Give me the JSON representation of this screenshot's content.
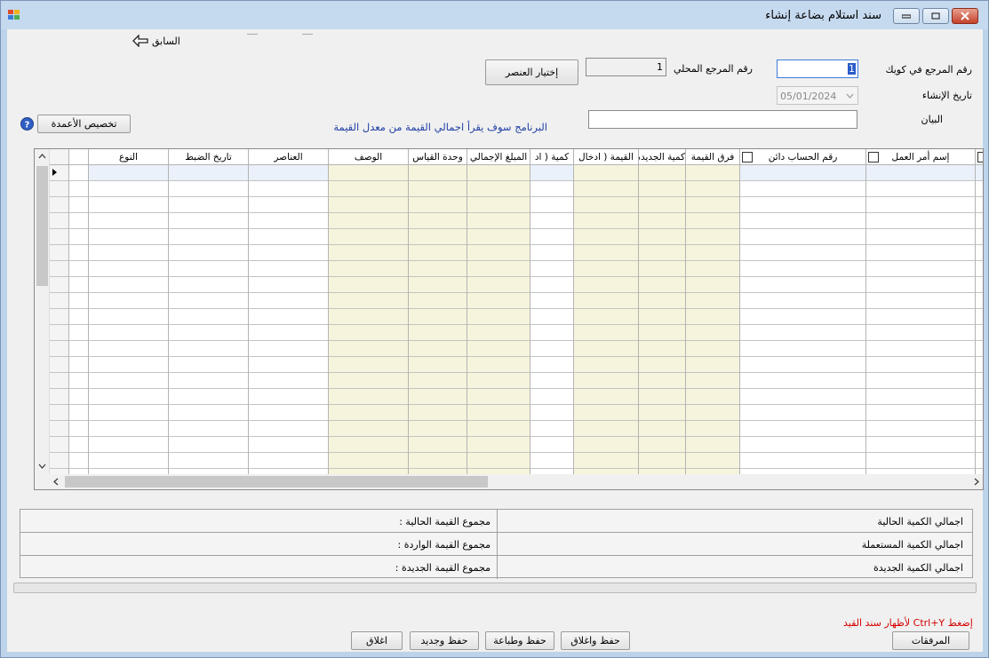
{
  "window": {
    "title": "سند استلام بضاعة إنشاء",
    "app_icon": "app-window-icon",
    "controls": [
      "minimize-icon",
      "maximize-icon",
      "close-icon"
    ]
  },
  "toolbar": {
    "back_label": "السابق",
    "back_icon": "arrow-left-icon"
  },
  "header": {
    "ref_kuwait_label": "رقم المرجع في كويك",
    "ref_kuwait_value": "1",
    "local_ref_label": "رقم المرجع المحلي",
    "local_ref_value": "1",
    "select_item_button": "إختيار العنصر",
    "created_date_label": "تاريخ الإنشاء",
    "created_date_value": "05/01/2024",
    "statement_label": "البيان",
    "statement_value": "",
    "info_text": "البرنامج سوف يقرأ اجمالي القيمة من معدل القيمة",
    "customize_columns_button": "تخصيص الأعمدة",
    "help_icon": "help-icon"
  },
  "grid": {
    "columns": [
      {
        "label": "إسم أمر العمل",
        "checkbox": true
      },
      {
        "label": "رقم الحساب دائن",
        "checkbox": true
      },
      {
        "label": "فرق القيمة",
        "checkbox": false
      },
      {
        "label": "كمية الجديدة",
        "checkbox": false
      },
      {
        "label": "القيمة ( ادخال",
        "checkbox": false
      },
      {
        "label": "كمية ( اد",
        "checkbox": false
      },
      {
        "label": "المبلغ الإجمالي",
        "checkbox": false
      },
      {
        "label": "وحدة القياس",
        "checkbox": false
      },
      {
        "label": "الوصف",
        "checkbox": false
      },
      {
        "label": "العناصر",
        "checkbox": false
      },
      {
        "label": "تاريخ الضبط",
        "checkbox": false
      },
      {
        "label": "النوع",
        "checkbox": false
      }
    ],
    "row_count": 20,
    "yellow_color": "#f6f4dc"
  },
  "summary": {
    "rows": [
      {
        "right": "اجمالي الكمية الحالية",
        "left": "مجموع القيمة الحالية :"
      },
      {
        "right": "اجمالي الكمية المستعملة",
        "left": "مجموع القيمة الواردة :"
      },
      {
        "right": "اجمالي الكمية الجديدة",
        "left": "مجموع القيمة الجديدة :"
      }
    ]
  },
  "footer": {
    "hint": "إضغط Ctrl+Y لأظهار سند القيد",
    "attachments_button": "المرفقات",
    "save_close_button": "حفظ واغلاق",
    "save_print_button": "حفظ وطباعة",
    "save_new_button": "حفظ وجديد",
    "close_button": "اغلاق"
  }
}
